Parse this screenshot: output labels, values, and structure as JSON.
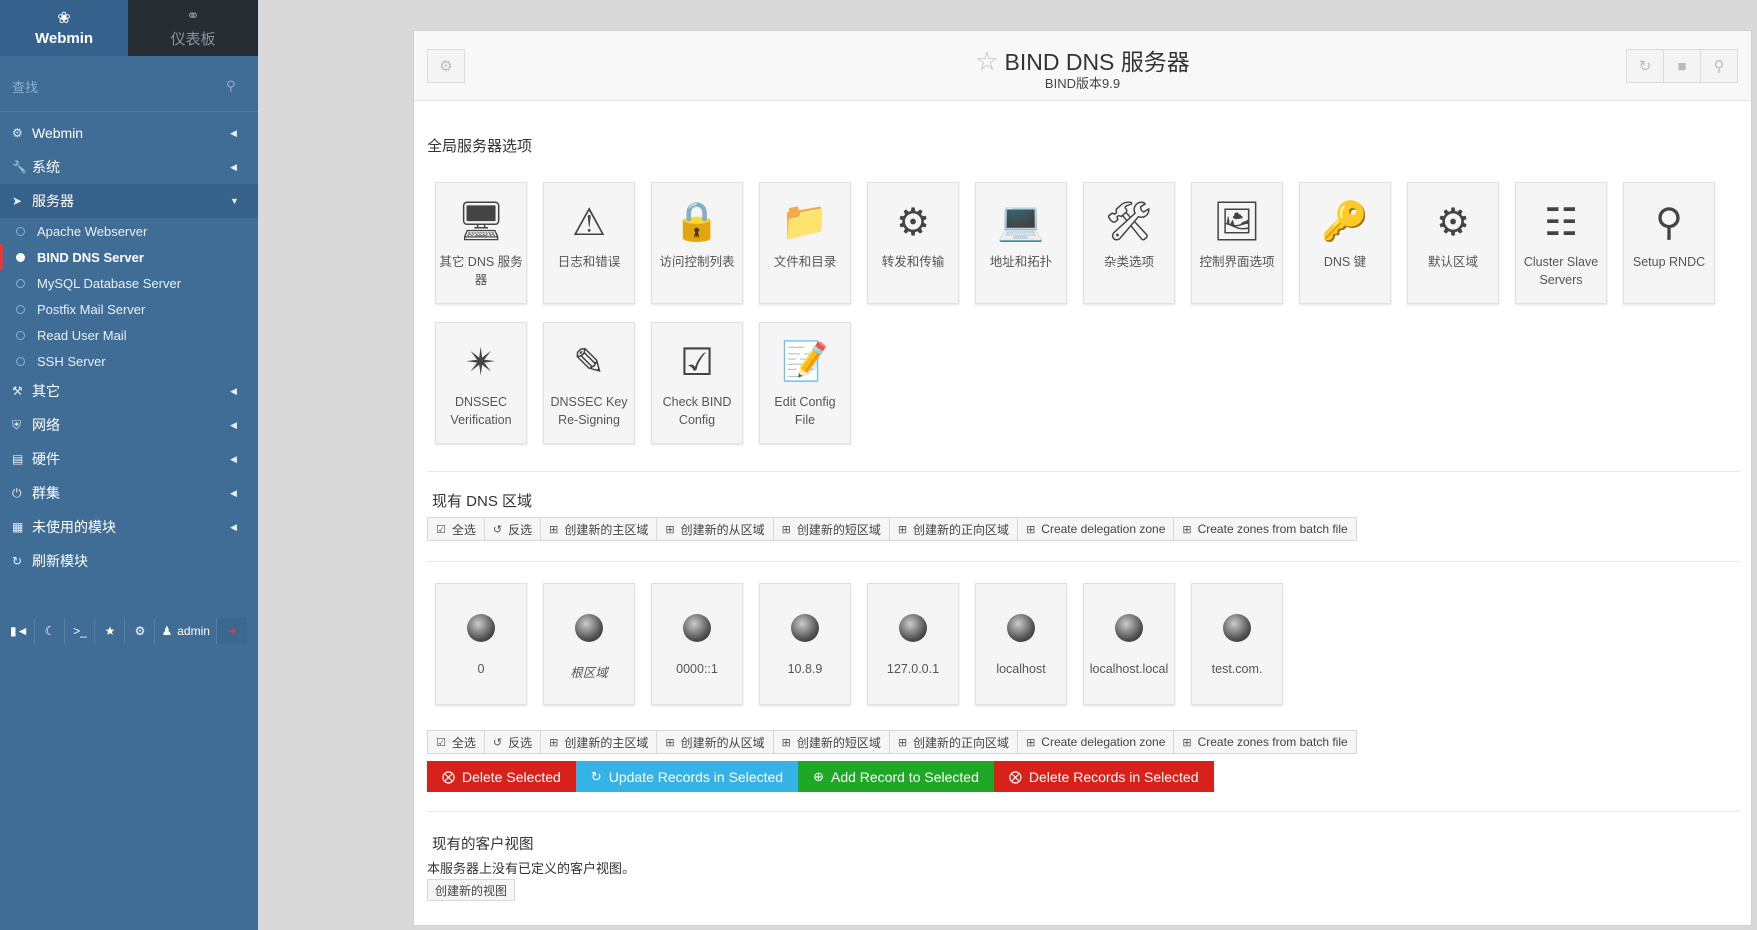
{
  "sidebar": {
    "tab_webmin": "Webmin",
    "tab_dashboard": "仪表板",
    "search_placeholder": "查找",
    "menu": [
      {
        "label": "Webmin",
        "icon": "gear-icon"
      },
      {
        "label": "系统",
        "icon": "wrench-icon"
      },
      {
        "label": "服务器",
        "icon": "rocket-icon",
        "active": true
      },
      {
        "label": "其它",
        "icon": "gavel-icon"
      },
      {
        "label": "网络",
        "icon": "shield-icon"
      },
      {
        "label": "硬件",
        "icon": "hdd-icon"
      },
      {
        "label": "群集",
        "icon": "power-icon"
      },
      {
        "label": "未使用的模块",
        "icon": "puzzle-icon"
      },
      {
        "label": "刷新模块",
        "icon": "refresh-icon"
      }
    ],
    "server_items": [
      "Apache Webserver",
      "BIND DNS Server",
      "MySQL Database Server",
      "Postfix Mail Server",
      "Read User Mail",
      "SSH Server"
    ],
    "current_item": "BIND DNS Server",
    "bottom_user": "admin"
  },
  "header": {
    "title": "BIND DNS 服务器",
    "subtitle": "BIND版本9.9"
  },
  "global_section": {
    "title": "全局服务器选项",
    "tiles": [
      {
        "label": "其它 DNS 服务器",
        "icon": "server-icon"
      },
      {
        "label": "日志和错误",
        "icon": "warning-icon"
      },
      {
        "label": "访问控制列表",
        "icon": "lock-icon"
      },
      {
        "label": "文件和目录",
        "icon": "folder-icon"
      },
      {
        "label": "转发和传输",
        "icon": "gears-icon"
      },
      {
        "label": "地址和拓扑",
        "icon": "computer-icon"
      },
      {
        "label": "杂类选项",
        "icon": "tools-icon"
      },
      {
        "label": "控制界面选项",
        "icon": "control-panel-icon"
      },
      {
        "label": "DNS 键",
        "icon": "key-icon"
      },
      {
        "label": "默认区域",
        "icon": "cog-icon"
      },
      {
        "label": "Cluster Slave Servers",
        "icon": "cluster-icon"
      },
      {
        "label": "Setup RNDC",
        "icon": "rndc-icon"
      },
      {
        "label": "DNSSEC Verification",
        "icon": "dnssec-verify-icon"
      },
      {
        "label": "DNSSEC Key Re-Signing",
        "icon": "key-resign-icon"
      },
      {
        "label": "Check BIND Config",
        "icon": "check-config-icon"
      },
      {
        "label": "Edit Config File",
        "icon": "edit-config-icon"
      }
    ]
  },
  "zones_section": {
    "title": "现有 DNS 区域",
    "toolbar": [
      {
        "label": "全选",
        "icon": "check-square-icon"
      },
      {
        "label": "反选",
        "icon": "invert-icon"
      },
      {
        "label": "创建新的主区域",
        "icon": "plus-square-icon"
      },
      {
        "label": "创建新的从区域",
        "icon": "plus-square-icon"
      },
      {
        "label": "创建新的短区域",
        "icon": "plus-square-icon"
      },
      {
        "label": "创建新的正向区域",
        "icon": "plus-square-icon"
      },
      {
        "label": "Create delegation zone",
        "icon": "plus-square-icon"
      },
      {
        "label": "Create zones from batch file",
        "icon": "plus-square-icon"
      }
    ],
    "zones": [
      "0",
      "根区域",
      "0000::1",
      "10.8.9",
      "127.0.0.1",
      "localhost",
      "localhost.local",
      "test.com."
    ],
    "actions": [
      {
        "label": "Delete Selected",
        "color": "#d9211b",
        "icon": "x-circle-icon"
      },
      {
        "label": "Update Records in Selected",
        "color": "#35b3e6",
        "icon": "refresh-icon"
      },
      {
        "label": "Add Record to Selected",
        "color": "#1ea826",
        "icon": "plus-circle-icon"
      },
      {
        "label": "Delete Records in Selected",
        "color": "#d9211b",
        "icon": "x-circle-icon"
      }
    ]
  },
  "views_section": {
    "title": "现有的客户视图",
    "message": "本服务器上没有已定义的客户视图。",
    "create_button": "创建新的视图"
  }
}
